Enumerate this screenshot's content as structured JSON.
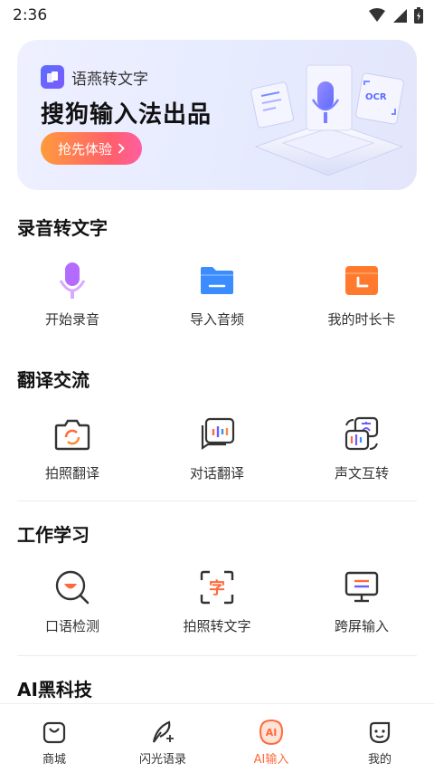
{
  "status_bar": {
    "time": "2:36"
  },
  "banner": {
    "brand_name": "语燕转文字",
    "title": "搜狗输入法出品",
    "cta_label": "抢先体验",
    "art_label": "OCR"
  },
  "sections": [
    {
      "title": "录音转文字",
      "items": [
        {
          "label": "开始录音",
          "icon": "microphone-icon"
        },
        {
          "label": "导入音频",
          "icon": "folder-icon"
        },
        {
          "label": "我的时长卡",
          "icon": "clock-card-icon"
        }
      ]
    },
    {
      "title": "翻译交流",
      "items": [
        {
          "label": "拍照翻译",
          "icon": "camera-translate-icon"
        },
        {
          "label": "对话翻译",
          "icon": "chat-translate-icon"
        },
        {
          "label": "声文互转",
          "icon": "voice-text-swap-icon"
        }
      ]
    },
    {
      "title": "工作学习",
      "items": [
        {
          "label": "口语检测",
          "icon": "speech-check-icon"
        },
        {
          "label": "拍照转文字",
          "icon": "photo-to-text-icon"
        },
        {
          "label": "跨屏输入",
          "icon": "cross-screen-icon"
        }
      ]
    },
    {
      "title": "AI黑科技"
    }
  ],
  "photo_text_glyph": "字",
  "bottom_nav": {
    "items": [
      {
        "label": "商城",
        "icon": "shop-bag-icon"
      },
      {
        "label": "闪光语录",
        "icon": "feather-icon"
      },
      {
        "label": "AI输入",
        "icon": "ai-input-icon",
        "badge": "AI"
      },
      {
        "label": "我的",
        "icon": "profile-icon"
      }
    ],
    "active_color": "#ff6a3d"
  },
  "colors": {
    "accent_orange": "#ff6a3d",
    "brand_purple": "#6a5cff",
    "folder_blue": "#3b8cff"
  }
}
